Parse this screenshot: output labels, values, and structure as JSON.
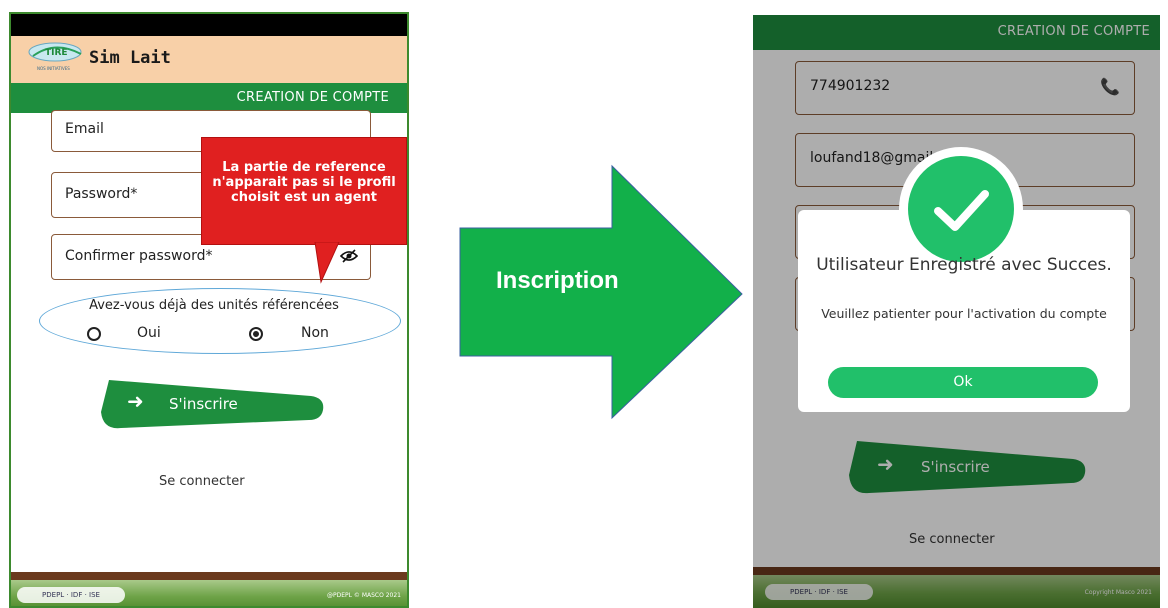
{
  "left_screen": {
    "app_name": "Sim Lait",
    "logo_text": "TIRE",
    "logo_subtext": "NOS INITIATIVES",
    "header_title": "CREATION DE COMPTE",
    "fields": {
      "email_label": "Email",
      "password_label": "Password*",
      "confirm_password_label": "Confirmer password*"
    },
    "tooltip_text": "La partie de reference n'apparait pas si le profil choisit est un agent",
    "question": "Avez-vous déjà des unités référencées",
    "options": [
      {
        "label": "Oui",
        "selected": false
      },
      {
        "label": "Non",
        "selected": true
      }
    ],
    "signup_button": "S'inscrire",
    "login_link": "Se connecter",
    "footer_logos": "PDEPL · IDF · ISE",
    "footer_copyright": "@PDEPL © MASCO 2021"
  },
  "arrow": {
    "label": "Inscription",
    "color": "#12b04a"
  },
  "right_screen": {
    "header_title": "CREATION DE COMPTE",
    "phone_value": "774901232",
    "email_value": "loufand18@gmail.com",
    "dialog": {
      "title": "Utilisateur Enregistré avec Succes.",
      "message": "Veuillez patienter pour l'activation du compte",
      "ok_button": "Ok"
    },
    "signup_button": "S'inscrire",
    "login_link": "Se connecter",
    "footer_logos": "PDEPL · IDF · ISE",
    "footer_copyright": "Copyright Masco 2021"
  },
  "colors": {
    "primary_green": "#1e8e3e",
    "success_green": "#21c06a",
    "tooltip_red": "#e02020",
    "field_border": "#8a5a3a"
  }
}
